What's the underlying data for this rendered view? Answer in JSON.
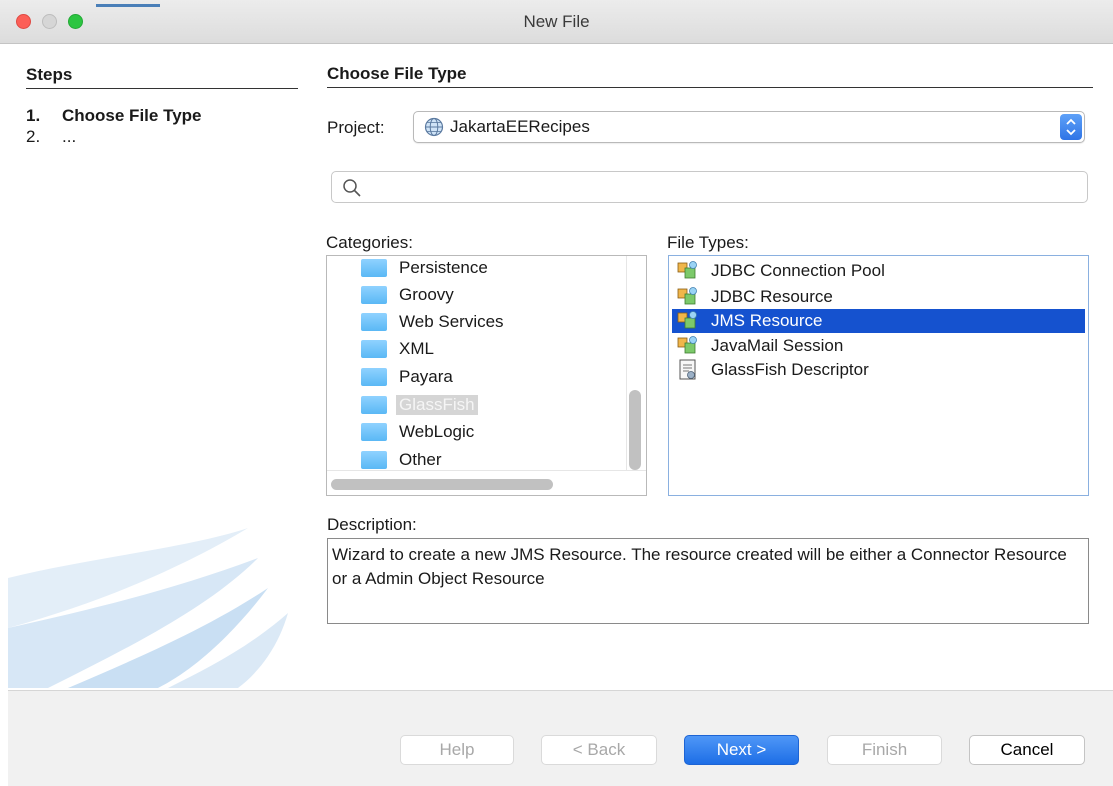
{
  "window": {
    "title": "New File"
  },
  "steps": {
    "heading": "Steps",
    "items": [
      {
        "num": "1.",
        "label": "Choose File Type"
      },
      {
        "num": "2.",
        "label": "..."
      }
    ]
  },
  "main": {
    "heading": "Choose File Type",
    "project_label": "Project:",
    "project_value": "JakartaEERecipes",
    "search_placeholder": "",
    "categories_label": "Categories:",
    "categories": [
      "Persistence",
      "Groovy",
      "Web Services",
      "XML",
      "Payara",
      "GlassFish",
      "WebLogic",
      "Other"
    ],
    "selected_category": "GlassFish",
    "file_types_label": "File Types:",
    "file_types": [
      "JDBC Connection Pool",
      "JDBC Resource",
      "JMS Resource",
      "JavaMail Session",
      "GlassFish Descriptor"
    ],
    "selected_file_type": "JMS Resource",
    "description_label": "Description:",
    "description": "Wizard to create a new JMS Resource. The resource created will be either a Connector Resource or a Admin Object Resource"
  },
  "buttons": {
    "help": "Help",
    "back": "< Back",
    "next": "Next >",
    "finish": "Finish",
    "cancel": "Cancel"
  },
  "colors": {
    "selection": "#1552cf",
    "primary_button": "#1d6ee6",
    "folder": "#5ab8f5"
  }
}
